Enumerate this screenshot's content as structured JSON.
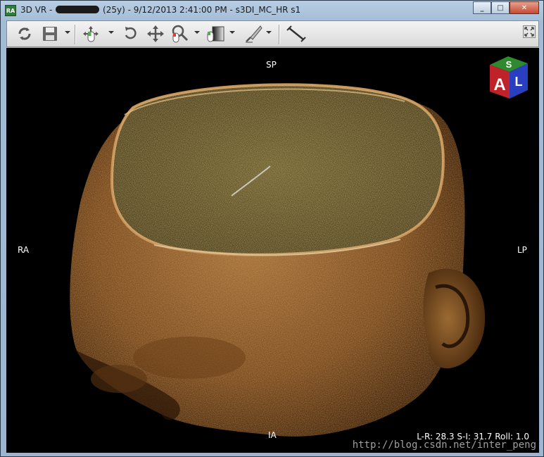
{
  "window": {
    "app_icon_label": "RA",
    "title_prefix": "3D VR - ",
    "title_suffix": " (25y) - 9/12/2013 2:41:00 PM - s3DI_MC_HR s1",
    "minimize_label": "_",
    "maximize_label": "□",
    "close_label": "✕"
  },
  "toolbar": {
    "tools": [
      {
        "name": "reset-view",
        "icon": "refresh-icon"
      },
      {
        "name": "save",
        "icon": "floppy-disk-icon"
      },
      {
        "name": "trackball-rotate",
        "icon": "trackball-icon"
      },
      {
        "name": "rotate",
        "icon": "rotate-icon"
      },
      {
        "name": "pan",
        "icon": "pan-arrows-icon"
      },
      {
        "name": "zoom",
        "icon": "magnifier-icon"
      },
      {
        "name": "window-level",
        "icon": "window-level-icon"
      },
      {
        "name": "scalpel",
        "icon": "scalpel-icon"
      },
      {
        "name": "measure",
        "icon": "ruler-icon"
      }
    ]
  },
  "viewport": {
    "orientation": {
      "top": "SP",
      "bottom": "IA",
      "left": "RA",
      "right": "LP"
    },
    "cube": {
      "top_face": "S",
      "front_face": "A",
      "side_face": "L",
      "top_color": "#2f8a2f",
      "front_color": "#c0222a",
      "side_color": "#2a3fbf"
    },
    "status_text": "L-R: 28.3 S-I: 31.7 Roll: 1.0",
    "watermark": "http://blog.csdn.net/inter_peng"
  },
  "colors": {
    "viewport_bg": "#000000",
    "volume_brown": "#8a5a26",
    "volume_highlight": "#c89a55"
  }
}
